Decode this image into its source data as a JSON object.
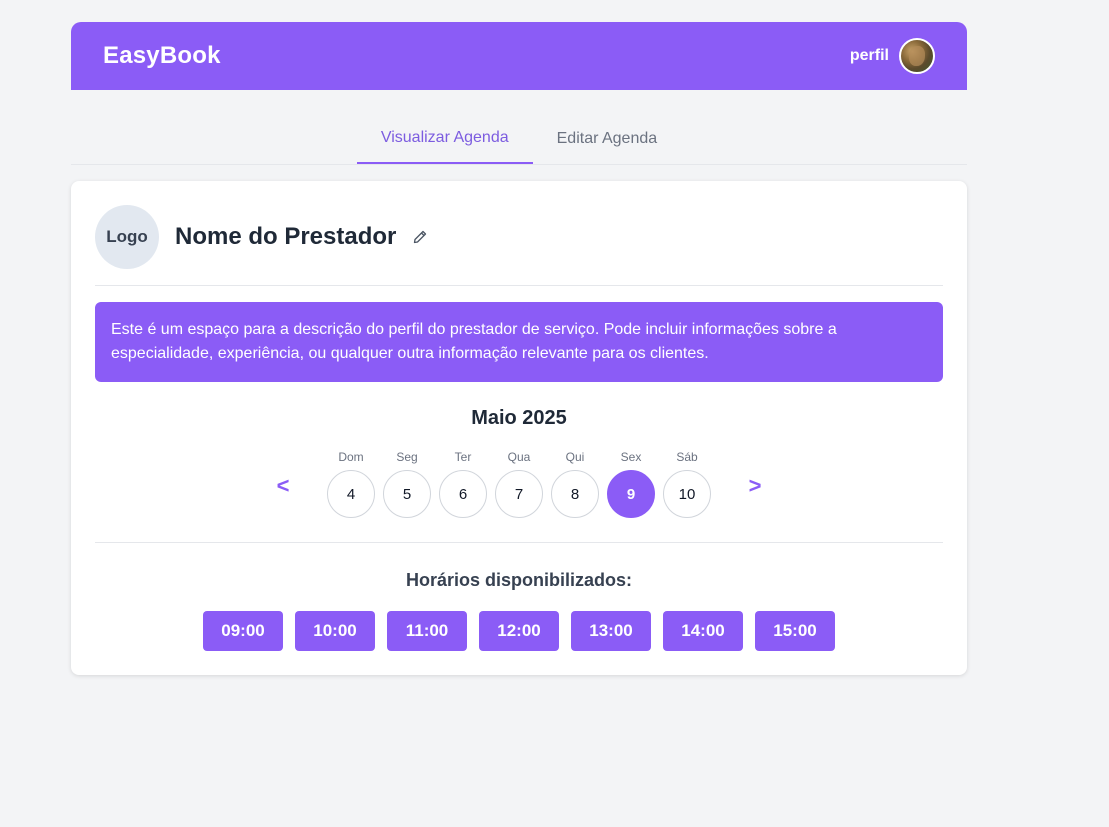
{
  "header": {
    "brand": "EasyBook",
    "profile_label": "perfil"
  },
  "tabs": [
    {
      "label": "Visualizar Agenda",
      "active": true
    },
    {
      "label": "Editar Agenda",
      "active": false
    }
  ],
  "provider": {
    "logo_text": "Logo",
    "name": "Nome do Prestador",
    "description": "Este é um espaço para a descrição do perfil do prestador de serviço. Pode incluir informações sobre a especialidade, experiência, ou qualquer outra informação relevante para os clientes."
  },
  "calendar": {
    "month_label": "Maio 2025",
    "prev_label": "<",
    "next_label": ">",
    "days": [
      {
        "name": "Dom",
        "num": "4",
        "selected": false
      },
      {
        "name": "Seg",
        "num": "5",
        "selected": false
      },
      {
        "name": "Ter",
        "num": "6",
        "selected": false
      },
      {
        "name": "Qua",
        "num": "7",
        "selected": false
      },
      {
        "name": "Qui",
        "num": "8",
        "selected": false
      },
      {
        "name": "Sex",
        "num": "9",
        "selected": true
      },
      {
        "name": "Sáb",
        "num": "10",
        "selected": false
      }
    ]
  },
  "slots": {
    "title": "Horários disponibilizados:",
    "times": [
      "09:00",
      "10:00",
      "11:00",
      "12:00",
      "13:00",
      "14:00",
      "15:00"
    ]
  },
  "colors": {
    "accent": "#8b5cf6",
    "background": "#f3f4f6"
  },
  "icons": {
    "edit": "pencil-icon",
    "avatar": "profile-avatar"
  }
}
